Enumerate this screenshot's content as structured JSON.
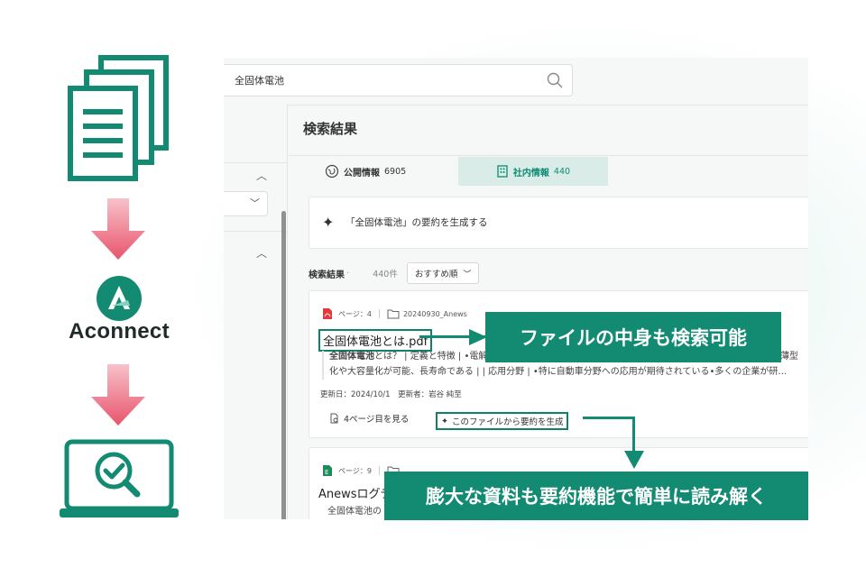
{
  "search": {
    "value": "全固体電池"
  },
  "brand": {
    "name": "Aconnect"
  },
  "colors": {
    "accent": "#138a72",
    "arrow": "#e8546b",
    "tab_active_bg": "#d9ece7"
  },
  "main": {
    "title": "検索結果",
    "tabs": [
      {
        "label": "公開情報",
        "count": "6905",
        "icon": "globe-icon",
        "active": false
      },
      {
        "label": "社内情報",
        "count": "440",
        "icon": "building-icon",
        "active": true
      }
    ],
    "summary_prompt": "「全固体電池」の要約を生成する",
    "results_label": "検索結果",
    "results_dot": "·",
    "results_count": "440件",
    "sort": "おすすめ順"
  },
  "results": [
    {
      "page": "ページ：4",
      "folder": "20240930_Anews",
      "title": "全固体電池とは.pdf",
      "snippet_line1_bold": "全固体電池",
      "snippet_line1": "とは？ | 定義と特徴 | •電解",
      "snippet_line1_tail": "•薄型",
      "snippet_line2": "化や大容量化が可能、長寿命である | | 応用分野 | •特に自動車分野への応用が期待されている•多くの企業が研…",
      "updated": "更新日：2024/10/1　更新者：岩谷 純至",
      "view_page": "4ページ目を見る",
      "summarize": "このファイルから要約を生成"
    },
    {
      "page": "ページ：9",
      "title": "Anewsログデ",
      "snippet": "全固体電池の"
    }
  ],
  "callouts": {
    "search_inside": "ファイルの中身も検索可能",
    "summarize": "膨大な資料も要約機能で簡単に読み解く"
  }
}
